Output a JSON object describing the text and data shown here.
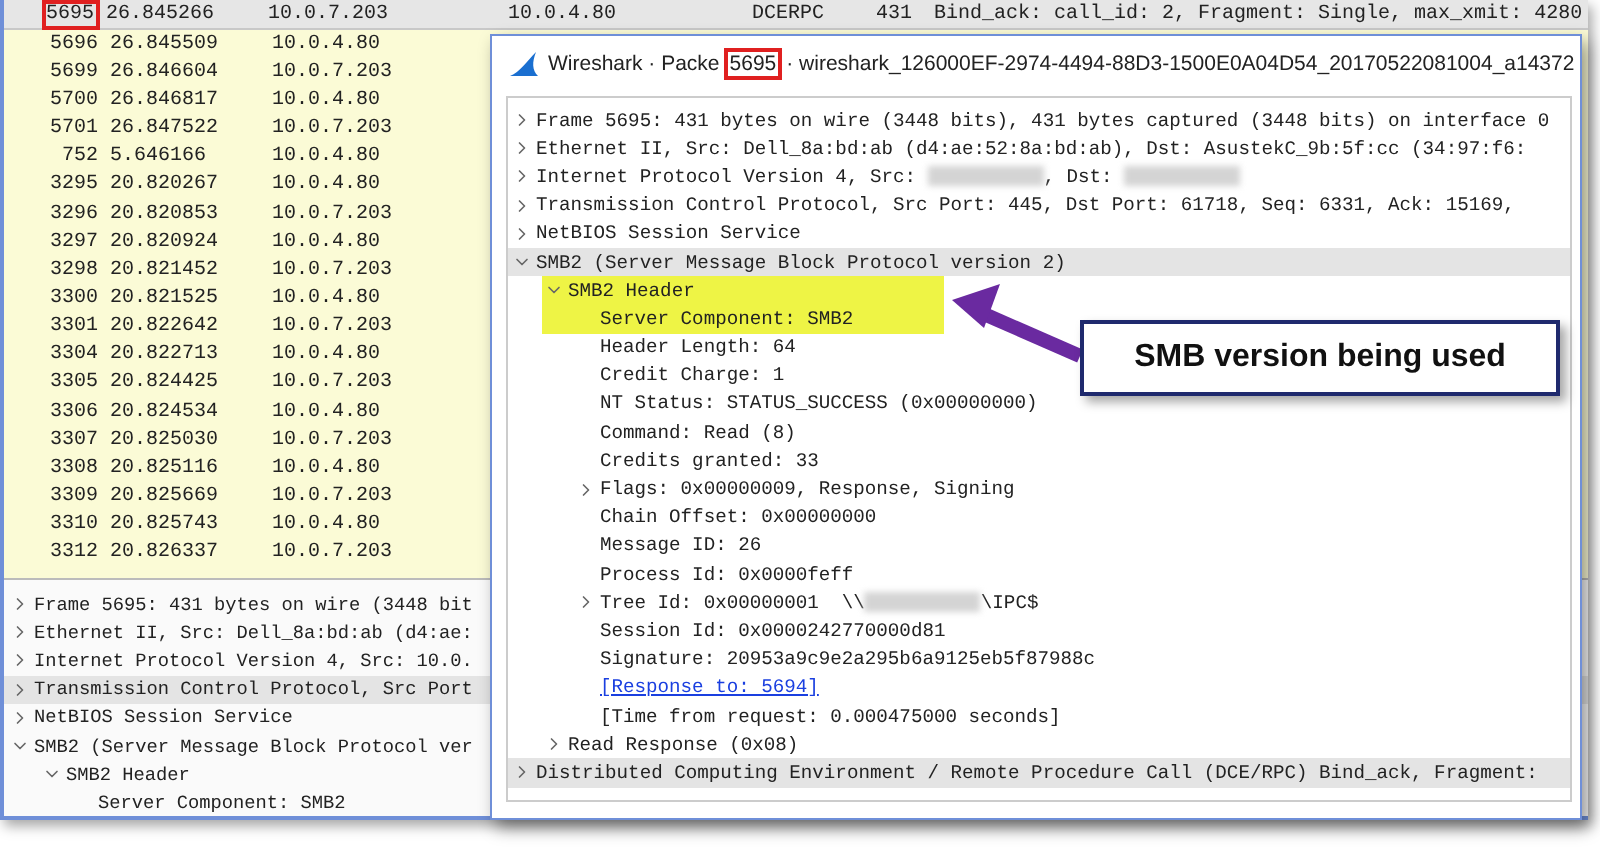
{
  "packet_list": {
    "rows": [
      {
        "no": "5695",
        "time": "26.845266",
        "source": "10.0.7.203",
        "destination": "10.0.4.80",
        "protocol": "DCERPC",
        "length": "431",
        "info": "Bind_ack: call_id: 2, Fragment: Single, max_xmit: 4280",
        "selected": true,
        "boxed": true
      },
      {
        "no": "5696",
        "time": "26.845509",
        "source": "10.0.4.80",
        "selected": false,
        "boxed": false
      },
      {
        "no": "5699",
        "time": "26.846604",
        "source": "10.0.7.203",
        "selected": false,
        "boxed": false
      },
      {
        "no": "5700",
        "time": "26.846817",
        "source": "10.0.4.80",
        "selected": false,
        "boxed": false
      },
      {
        "no": "5701",
        "time": "26.847522",
        "source": "10.0.7.203",
        "selected": false,
        "boxed": false
      },
      {
        "no": "752",
        "time": "5.646166",
        "source": "10.0.4.80",
        "selected": false,
        "boxed": false
      },
      {
        "no": "3295",
        "time": "20.820267",
        "source": "10.0.4.80",
        "selected": false,
        "boxed": false
      },
      {
        "no": "3296",
        "time": "20.820853",
        "source": "10.0.7.203",
        "selected": false,
        "boxed": false
      },
      {
        "no": "3297",
        "time": "20.820924",
        "source": "10.0.4.80",
        "selected": false,
        "boxed": false
      },
      {
        "no": "3298",
        "time": "20.821452",
        "source": "10.0.7.203",
        "selected": false,
        "boxed": false
      },
      {
        "no": "3300",
        "time": "20.821525",
        "source": "10.0.4.80",
        "selected": false,
        "boxed": false
      },
      {
        "no": "3301",
        "time": "20.822642",
        "source": "10.0.7.203",
        "selected": false,
        "boxed": false
      },
      {
        "no": "3304",
        "time": "20.822713",
        "source": "10.0.4.80",
        "selected": false,
        "boxed": false
      },
      {
        "no": "3305",
        "time": "20.824425",
        "source": "10.0.7.203",
        "selected": false,
        "boxed": false
      },
      {
        "no": "3306",
        "time": "20.824534",
        "source": "10.0.4.80",
        "selected": false,
        "boxed": false
      },
      {
        "no": "3307",
        "time": "20.825030",
        "source": "10.0.7.203",
        "selected": false,
        "boxed": false
      },
      {
        "no": "3308",
        "time": "20.825116",
        "source": "10.0.4.80",
        "selected": false,
        "boxed": false
      },
      {
        "no": "3309",
        "time": "20.825669",
        "source": "10.0.7.203",
        "selected": false,
        "boxed": false
      },
      {
        "no": "3310",
        "time": "20.825743",
        "source": "10.0.4.80",
        "selected": false,
        "boxed": false
      },
      {
        "no": "3312",
        "time": "20.826337",
        "source": "10.0.7.203",
        "selected": false,
        "boxed": false
      }
    ]
  },
  "details_pane": {
    "items": [
      {
        "label": "Frame 5695: 431 bytes on wire (3448 bit",
        "expanded": false,
        "selected": false
      },
      {
        "label": "Ethernet II, Src: Dell_8a:bd:ab (d4:ae:",
        "expanded": false,
        "selected": false
      },
      {
        "label": "Internet Protocol Version 4, Src: 10.0.",
        "expanded": false,
        "selected": false
      },
      {
        "label": "Transmission Control Protocol, Src Port",
        "expanded": false,
        "selected": true
      },
      {
        "label": "NetBIOS Session Service",
        "expanded": false,
        "selected": false
      },
      {
        "label": "SMB2 (Server Message Block Protocol ver",
        "expanded": true,
        "selected": false,
        "children": [
          {
            "label": "SMB2 Header",
            "expanded": true,
            "selected": false,
            "children": [
              {
                "label": "Server Component: SMB2",
                "selected": false
              }
            ]
          }
        ]
      }
    ]
  },
  "packet_dialog": {
    "title": [
      {
        "kind": "text",
        "text": "Wireshark · Packe"
      },
      {
        "kind": "boxed",
        "text": "5695"
      },
      {
        "kind": "text",
        "text": "· wireshark_126000EF-2974-4494-88D3-1500E0A04D54_20170522081004_a14372"
      }
    ],
    "items": [
      {
        "label": "Frame 5695: 431 bytes on wire (3448 bits), 431 bytes captured (3448 bits) on interface 0",
        "expanded": false,
        "selected": false
      },
      {
        "label": "Ethernet II, Src: Dell_8a:bd:ab (d4:ae:52:8a:bd:ab), Dst: AsustekC_9b:5f:cc (34:97:f6:",
        "expanded": false,
        "selected": false
      },
      {
        "parts": [
          {
            "kind": "text",
            "text": "Internet Protocol Version 4, Src: "
          },
          {
            "kind": "redacted"
          },
          {
            "kind": "text",
            "text": ", Dst: "
          },
          {
            "kind": "redacted"
          }
        ],
        "expanded": false,
        "selected": false
      },
      {
        "label": "Transmission Control Protocol, Src Port: 445, Dst Port: 61718, Seq: 6331, Ack: 15169,",
        "expanded": false,
        "selected": false
      },
      {
        "label": "NetBIOS Session Service",
        "expanded": false,
        "selected": false
      },
      {
        "label": "SMB2 (Server Message Block Protocol version 2)",
        "expanded": true,
        "selected": true,
        "children": [
          {
            "label": "SMB2 Header",
            "expanded": true,
            "selected": false,
            "highlighted": true,
            "children": [
              {
                "label": "Server Component: SMB2",
                "selected": false,
                "highlighted": true
              },
              {
                "label": "Header Length: 64",
                "selected": false,
                "highlighted": false
              },
              {
                "label": "Credit Charge: 1",
                "selected": false,
                "highlighted": false
              },
              {
                "label": "NT Status: STATUS_SUCCESS (0x00000000)",
                "selected": false,
                "highlighted": false
              },
              {
                "label": "Command: Read (8)",
                "selected": false,
                "highlighted": false
              },
              {
                "label": "Credits granted: 33",
                "selected": false,
                "highlighted": false
              },
              {
                "label": "Flags: 0x00000009, Response, Signing",
                "expanded": false,
                "selected": false,
                "highlighted": false
              },
              {
                "label": "Chain Offset: 0x00000000",
                "selected": false,
                "highlighted": false
              },
              {
                "label": "Message ID: 26",
                "selected": false,
                "highlighted": false
              },
              {
                "label": "Process Id: 0x0000feff",
                "selected": false,
                "highlighted": false
              },
              {
                "parts": [
                  {
                    "kind": "text",
                    "text": "Tree Id: 0x00000001  \\\\"
                  },
                  {
                    "kind": "redacted"
                  },
                  {
                    "kind": "text",
                    "text": "\\IPC$"
                  }
                ],
                "expanded": false,
                "selected": false,
                "highlighted": false
              },
              {
                "label": "Session Id: 0x0000242770000d81",
                "selected": false,
                "highlighted": false
              },
              {
                "label": "Signature: 20953a9c9e2a295b6a9125eb5f87988c",
                "selected": false,
                "highlighted": false
              },
              {
                "label": "[Response to: 5694]",
                "kind": "link",
                "selected": false,
                "highlighted": false
              },
              {
                "label": "[Time from request: 0.000475000 seconds]",
                "selected": false,
                "highlighted": false
              }
            ]
          },
          {
            "label": "Read Response (0x08)",
            "expanded": false,
            "selected": false,
            "highlighted": false
          }
        ]
      },
      {
        "label": "Distributed Computing Environment / Remote Procedure Call (DCE/RPC) Bind_ack, Fragment:",
        "expanded": false,
        "selected": true
      }
    ]
  },
  "callout": {
    "text": "SMB version being used"
  }
}
